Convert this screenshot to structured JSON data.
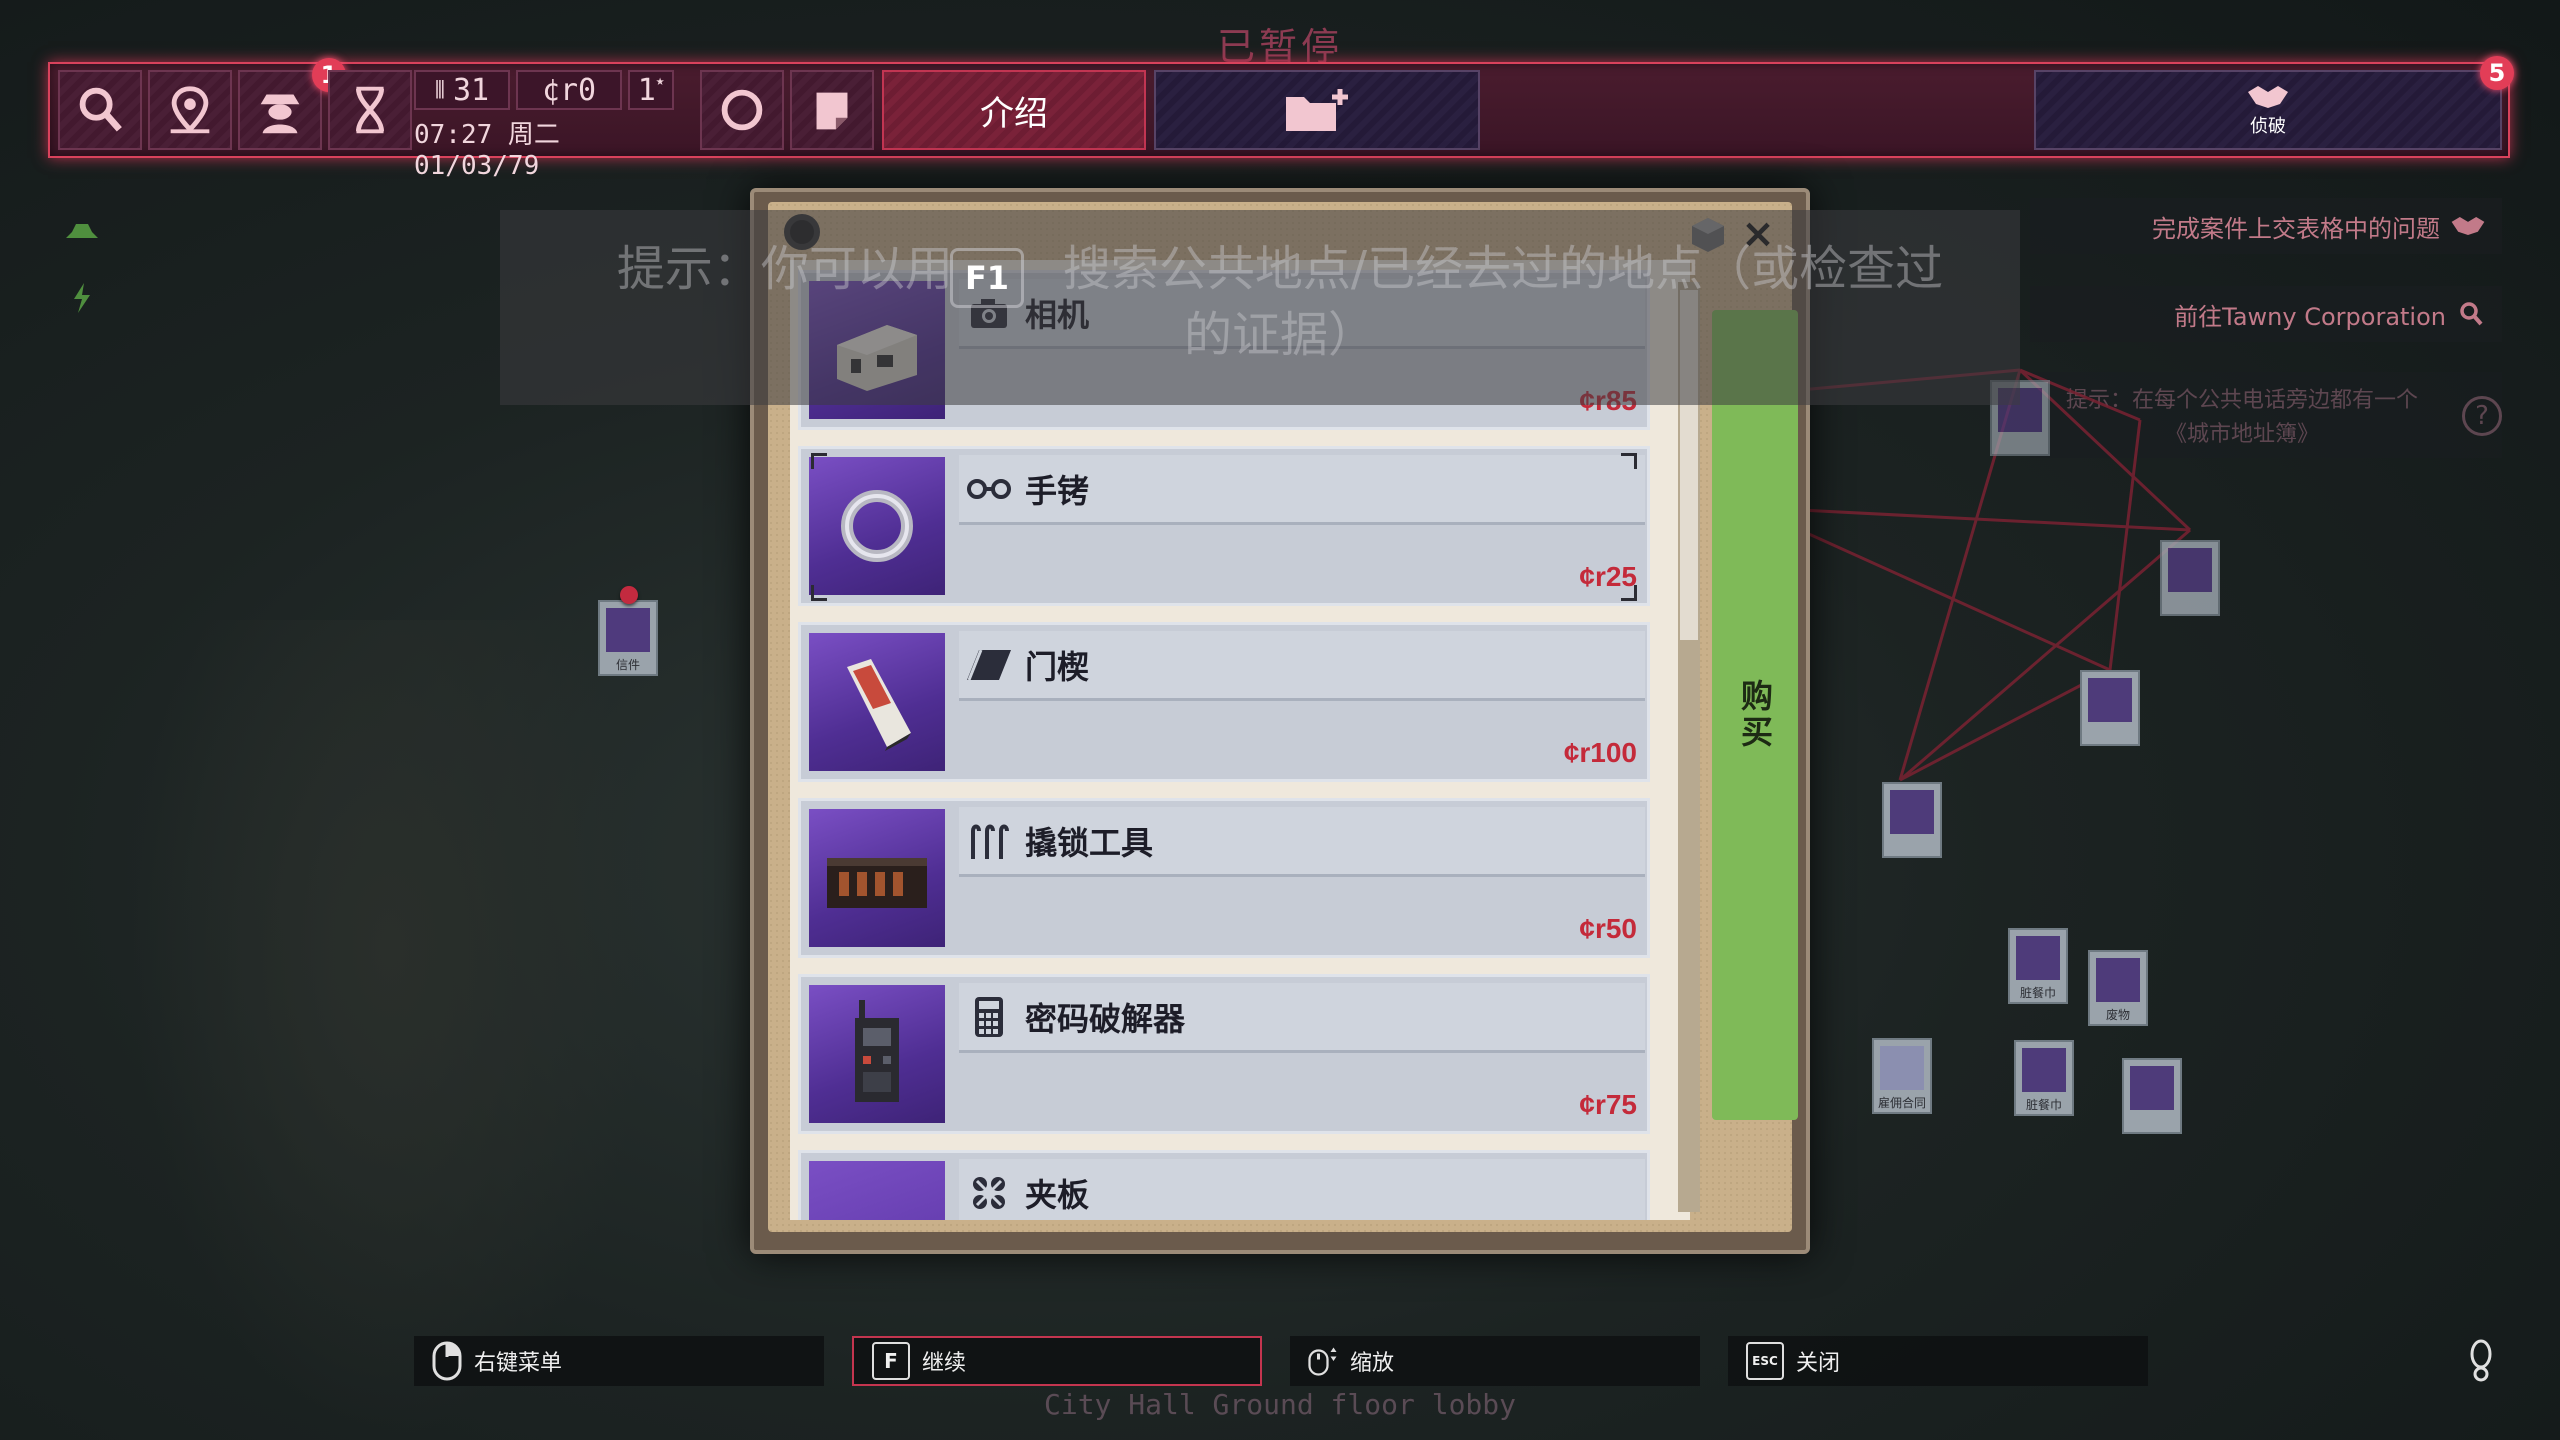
{
  "status": {
    "paused": "已暂停"
  },
  "topbar": {
    "search_icon": "magnifier-icon",
    "map_icon": "map-pin-icon",
    "person_icon": "detective-icon",
    "person_badge": "1",
    "dna_icon": "dna-icon",
    "lockpicks": "31",
    "money": "¢r0",
    "stars": "1",
    "datetime": "07:27 周二 01/03/79",
    "intro_label": "介绍",
    "folder_icon": "folder-add-icon",
    "handshake_label": "侦破",
    "handshake_badge": "5"
  },
  "objectives": [
    {
      "text": "完成案件上交表格中的问题",
      "icon": "handshake-icon"
    },
    {
      "text": "前往Tawny Corporation",
      "icon": "magnifier-icon"
    }
  ],
  "hint_objective": "提示：在每个公共电话旁边都有一个《城市地址簿》",
  "hint": {
    "line1_a": "提示：你可以用",
    "key": "F1",
    "line1_b": "搜索公共地点/已经去过的地点（或检查过",
    "line2": "的证据）"
  },
  "shop": {
    "buy_label": "购买",
    "close": "×",
    "items": [
      {
        "name": "相机",
        "icon": "camera-icon",
        "price": "¢r85"
      },
      {
        "name": "手铐",
        "icon": "handcuffs-icon",
        "price": "¢r25"
      },
      {
        "name": "门楔",
        "icon": "door-wedge-icon",
        "price": "¢r100"
      },
      {
        "name": "撬锁工具",
        "icon": "lockpick-icon",
        "price": "¢r50"
      },
      {
        "name": "密码破解器",
        "icon": "calculator-icon",
        "price": "¢r75"
      },
      {
        "name": "夹板",
        "icon": "splint-icon",
        "price": ""
      }
    ]
  },
  "board_notes": [
    {
      "label": "信件"
    },
    {
      "label": "脏餐巾"
    },
    {
      "label": "废物"
    },
    {
      "label": "雇佣合同"
    },
    {
      "label": "脏餐巾"
    }
  ],
  "controls": [
    {
      "key": "mouse-right",
      "label": "右键菜单"
    },
    {
      "key": "F",
      "label": "继续"
    },
    {
      "key": "mouse-scroll",
      "label": "缩放"
    },
    {
      "key": "ESC",
      "label": "关闭"
    }
  ],
  "location": "City Hall Ground floor lobby",
  "colors": {
    "accent": "#d9425c",
    "buy": "#7fba58",
    "price": "#c42a3a"
  }
}
